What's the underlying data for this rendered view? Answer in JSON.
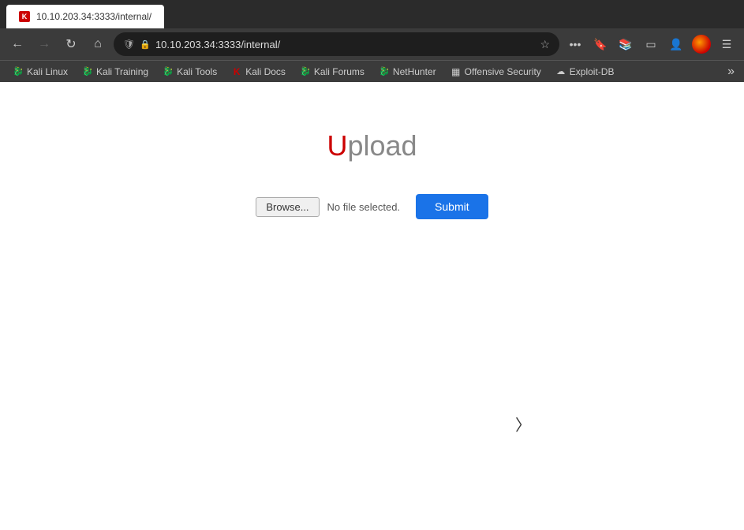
{
  "browser": {
    "tab_label": "10.10.203.34:3333/internal/",
    "url": "10.10.203.34:3333/internal/",
    "url_display": "10.10.203.34:3333/internal/"
  },
  "bookmarks": [
    {
      "label": "Kali Linux",
      "icon": "🐉",
      "icon_color": "#4db8ff"
    },
    {
      "label": "Kali Training",
      "icon": "🐉",
      "icon_color": "#4db8ff"
    },
    {
      "label": "Kali Tools",
      "icon": "🐉",
      "icon_color": "#4db8ff"
    },
    {
      "label": "Kali Docs",
      "icon": "K",
      "icon_color": "#cc0000"
    },
    {
      "label": "Kali Forums",
      "icon": "🐉",
      "icon_color": "#4db8ff"
    },
    {
      "label": "NetHunter",
      "icon": "🐉",
      "icon_color": "#4db8ff"
    },
    {
      "label": "Offensive Security",
      "icon": "▦",
      "icon_color": "#888"
    },
    {
      "label": "Exploit-DB",
      "icon": "☁",
      "icon_color": "#999"
    }
  ],
  "page": {
    "title_prefix": "U",
    "title_suffix": "pload",
    "browse_label": "Browse...",
    "no_file_label": "No file selected.",
    "submit_label": "Submit"
  },
  "nav": {
    "back_disabled": false,
    "forward_disabled": true,
    "more_label": "»"
  }
}
